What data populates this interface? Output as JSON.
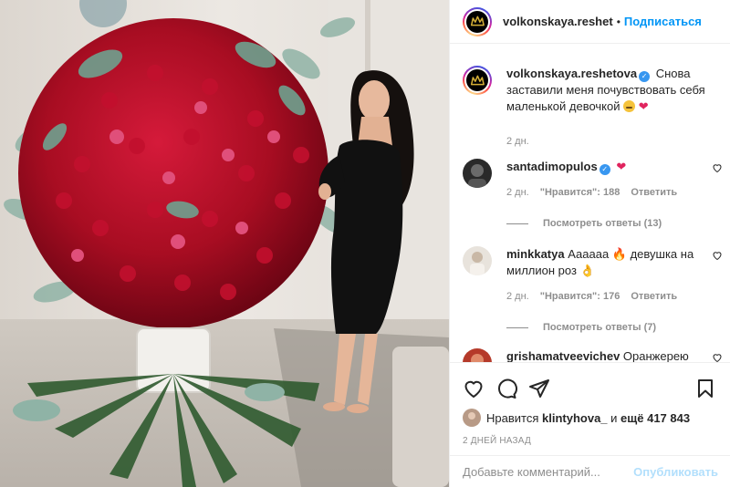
{
  "header": {
    "username": "volkonskaya.reshet",
    "separator": "•",
    "follow_label": "Подписаться"
  },
  "caption": {
    "username": "volkonskaya.reshetova",
    "text": "Снова заставили меня почувствовать себя маленькой девочкой",
    "heart": "❤",
    "time": "2 дн."
  },
  "comments": [
    {
      "username": "santadimopulos",
      "verified": true,
      "text": "❤",
      "time": "2 дн.",
      "likes": "\"Нравится\": 188",
      "reply": "Ответить",
      "view_replies": "Посмотреть ответы (13)"
    },
    {
      "username": "minkkatya",
      "verified": false,
      "text": "Аааааа 🔥 девушка на миллион роз 👌",
      "time": "2 дн.",
      "likes": "\"Нравится\": 176",
      "reply": "Ответить",
      "view_replies": "Посмотреть ответы (7)"
    },
    {
      "username": "grishamatveevichev",
      "verified": false,
      "text": "Оранжерею",
      "time": "",
      "likes": "",
      "reply": "",
      "view_replies": ""
    }
  ],
  "likes": {
    "prefix": "Нравится",
    "user": "klintyhova_",
    "middle": "и",
    "count": "ещё 417 843"
  },
  "post_date": "2 ДНЕЙ НАЗАД",
  "add_comment": {
    "placeholder": "Добавьте комментарий...",
    "publish_label": "Опубликовать"
  },
  "icons": {
    "like": "heart-icon",
    "comment": "comment-icon",
    "share": "share-icon",
    "save": "bookmark-icon",
    "comment_like": "small-heart-icon"
  },
  "colors": {
    "accent": "#0095f6",
    "publish_disabled": "#b2dffc",
    "muted": "#8e8e8e",
    "verified": "#3897f0"
  }
}
